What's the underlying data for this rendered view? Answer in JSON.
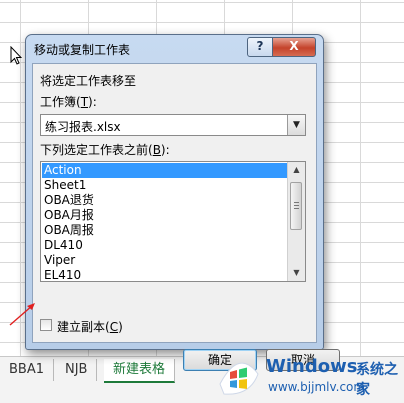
{
  "dialog": {
    "title": "移动或复制工作表",
    "help_label": "?",
    "close_label": "X",
    "move_label": "将选定工作表移至",
    "workbook_label": "工作簿(",
    "workbook_key": "T",
    "workbook_label_end": "):",
    "workbook_value": "练习报表.xlsx",
    "before_label": "下列选定工作表之前(",
    "before_key": "B",
    "before_label_end": "):",
    "sheets": [
      "Action",
      "Sheet1",
      "OBA退货",
      "OBA月报",
      "OBA周报",
      "DL410",
      "Viper",
      "EL410"
    ],
    "selected_sheet": "Action",
    "copy_label": "建立副本(",
    "copy_key": "C",
    "copy_label_end": ")",
    "copy_checked": false,
    "ok_label": "确定",
    "cancel_label": "取消"
  },
  "sheet_tabs": [
    "BBA1",
    "NJB",
    "新建表格"
  ],
  "active_tab": "新建表格",
  "watermark": {
    "brand": "Windows",
    "cn": "系统之家",
    "url": "www.bjjmlv.com"
  },
  "colors": {
    "selection": "#3399ff",
    "dialog_frame": "#c7daf1",
    "close_button": "#c4432b",
    "annotation_arrow": "#e02020",
    "watermark": "#1d5fb0"
  }
}
